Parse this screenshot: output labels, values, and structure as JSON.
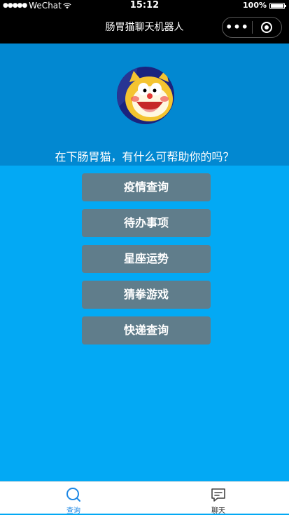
{
  "status_bar": {
    "carrier": "WeChat",
    "time": "15:12",
    "battery": "100%"
  },
  "nav": {
    "title": "肠胃猫聊天机器人",
    "more": "•••"
  },
  "greeting": "在下肠胃猫，有什么可帮助你的吗？",
  "menu": [
    {
      "label": "疫情查询"
    },
    {
      "label": "待办事项"
    },
    {
      "label": "星座运势"
    },
    {
      "label": "猜拳游戏"
    },
    {
      "label": "快递查询"
    }
  ],
  "tabs": [
    {
      "label": "查询",
      "active": true,
      "color": "#1e88e5",
      "icon": "search-icon"
    },
    {
      "label": "聊天",
      "active": false,
      "color": "#333333",
      "icon": "chat-icon"
    }
  ],
  "colors": {
    "background": "#03a9f4",
    "header": "#0288d1",
    "button": "#607d8b"
  }
}
